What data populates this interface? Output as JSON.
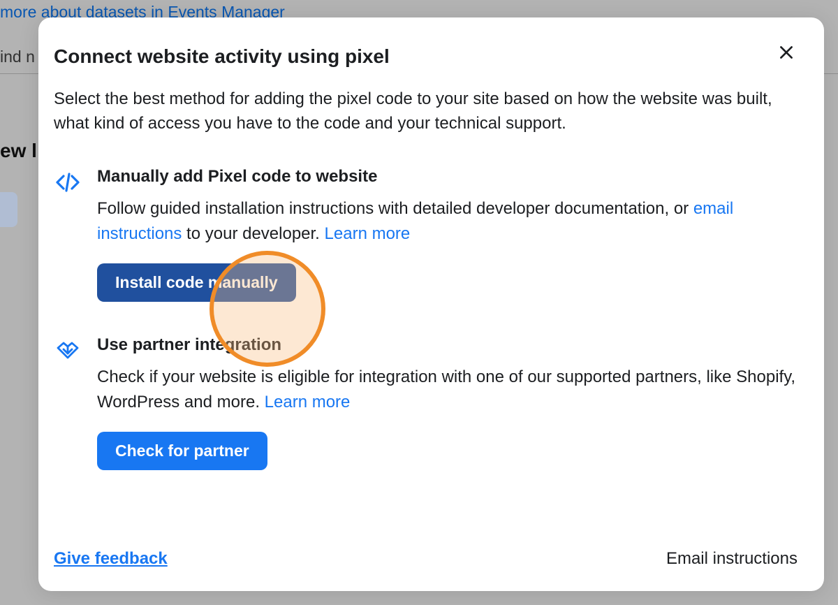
{
  "background": {
    "link_text": "more about datasets in Events Manager",
    "text_fragment_1": "ind n",
    "text_fragment_2": "ew l"
  },
  "modal": {
    "title": "Connect website activity using pixel",
    "description": "Select the best method for adding the pixel code to your site based on how the website was built, what kind of access you have to the code and your technical support.",
    "options": {
      "manual": {
        "title": "Manually add Pixel code to website",
        "text_before_link1": "Follow guided installation instructions with detailed developer documentation, or ",
        "link1": "email instructions",
        "text_middle": " to your developer. ",
        "link2": "Learn more",
        "button": "Install code manually"
      },
      "partner": {
        "title": "Use partner integration",
        "text_before_link": "Check if your website is eligible for integration with one of our supported partners, like Shopify, WordPress and more. ",
        "link": "Learn more",
        "button": "Check for partner"
      }
    },
    "footer": {
      "feedback": "Give feedback",
      "email": "Email instructions"
    }
  }
}
